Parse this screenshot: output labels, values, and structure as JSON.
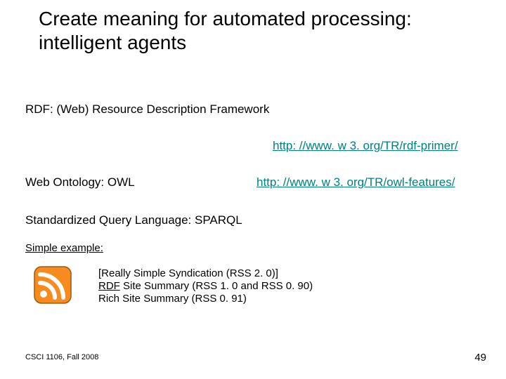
{
  "title": "Create meaning for automated processing: intelligent agents",
  "rdf_label": "RDF: (Web) Resource Description Framework",
  "link_rdf": "http: //www. w 3. org/TR/rdf-primer/",
  "owl_label": "Web Ontology: OWL",
  "link_owl": "http: //www. w 3. org/TR/owl-features/",
  "sparql_label": "Standardized Query Language: SPARQL",
  "simple_example": "Simple example:",
  "rss": {
    "line1": "[Really Simple Syndication (RSS 2. 0)]",
    "line2_u": "RDF",
    "line2_rest": " Site Summary (RSS 1. 0 and RSS 0. 90)",
    "line3": "Rich Site Summary (RSS 0. 91)"
  },
  "footer_left": "CSCI 1106, Fall 2008",
  "footer_right": "49"
}
